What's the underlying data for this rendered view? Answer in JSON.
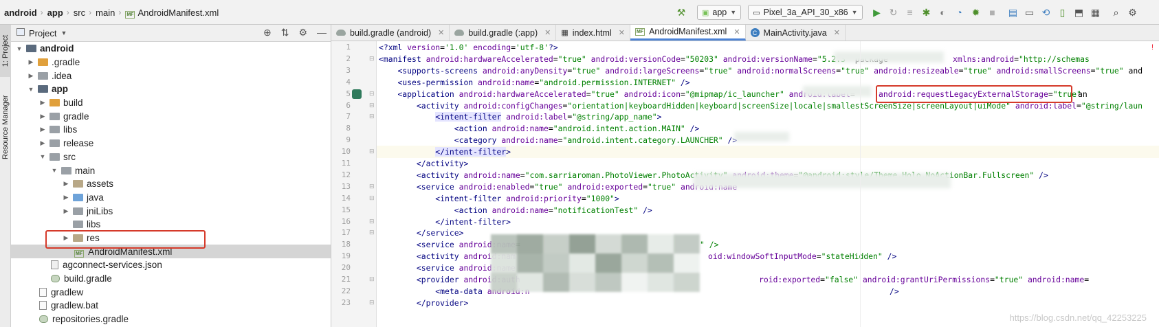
{
  "navbar": {
    "crumbs": [
      "android",
      "app",
      "src",
      "main",
      "AndroidManifest.xml"
    ],
    "file_badge": "MF",
    "run_config": "app",
    "device": "Pixel_3a_API_30_x86"
  },
  "left_strip": {
    "project_tab": "1: Project",
    "resource_tab": "Resource Manager"
  },
  "project_panel": {
    "title": "Project",
    "tree": [
      {
        "label": "android",
        "bold": true,
        "expanded": true,
        "icon": "folder-module"
      },
      {
        "label": ".gradle",
        "bold": false,
        "expanded": false,
        "icon": "folder-orange"
      },
      {
        "label": ".idea",
        "bold": false,
        "expanded": false,
        "icon": "folder-gray"
      },
      {
        "label": "app",
        "bold": true,
        "expanded": true,
        "icon": "folder-module"
      },
      {
        "label": "build",
        "bold": false,
        "expanded": false,
        "icon": "folder-orange"
      },
      {
        "label": "gradle",
        "bold": false,
        "expanded": false,
        "icon": "folder-gray"
      },
      {
        "label": "libs",
        "bold": false,
        "expanded": false,
        "icon": "folder-gray"
      },
      {
        "label": "release",
        "bold": false,
        "expanded": false,
        "icon": "folder-gray"
      },
      {
        "label": "src",
        "bold": false,
        "expanded": true,
        "icon": "folder-gray"
      },
      {
        "label": "main",
        "bold": false,
        "expanded": true,
        "icon": "folder-gray"
      },
      {
        "label": "assets",
        "bold": false,
        "expanded": false,
        "icon": "folder-assets"
      },
      {
        "label": "java",
        "bold": false,
        "expanded": false,
        "icon": "folder-blue"
      },
      {
        "label": "jniLibs",
        "bold": false,
        "expanded": false,
        "icon": "folder-gray"
      },
      {
        "label": "libs",
        "bold": false,
        "expanded": null,
        "icon": "folder-gray"
      },
      {
        "label": "res",
        "bold": false,
        "expanded": false,
        "icon": "folder-res"
      },
      {
        "label": "AndroidManifest.xml",
        "bold": false,
        "expanded": null,
        "icon": "manifest-file"
      },
      {
        "label": "agconnect-services.json",
        "bold": false,
        "expanded": null,
        "icon": "json-file"
      },
      {
        "label": "build.gradle",
        "bold": false,
        "expanded": null,
        "icon": "gradle-file"
      },
      {
        "label": "gradlew",
        "bold": false,
        "expanded": null,
        "icon": "text-file"
      },
      {
        "label": "gradlew.bat",
        "bold": false,
        "expanded": null,
        "icon": "text-file"
      },
      {
        "label": "repositories.gradle",
        "bold": false,
        "expanded": null,
        "icon": "gradle-file"
      }
    ]
  },
  "tabs": [
    {
      "label": "build.gradle (android)",
      "icon": "gradle-icon",
      "active": false
    },
    {
      "label": "build.gradle (:app)",
      "icon": "gradle-icon",
      "active": false
    },
    {
      "label": "index.html",
      "icon": "html-icon",
      "active": false
    },
    {
      "label": "AndroidManifest.xml",
      "icon": "manifest-icon",
      "active": true
    },
    {
      "label": "MainActivity.java",
      "icon": "java-class-icon",
      "active": false
    }
  ],
  "line_numbers": [
    "1",
    "2",
    "3",
    "4",
    "5",
    "6",
    "7",
    "8",
    "9",
    "10",
    "11",
    "12",
    "13",
    "14",
    "15",
    "16",
    "17",
    "18",
    "19",
    "20",
    "21",
    "22",
    "23"
  ],
  "code": [
    "<?xml version='1.0' encoding='utf-8'?>",
    "<manifest android:hardwareAccelerated=\"true\" android:versionCode=\"50203\" android:versionName=\"5.2.3\" package",
    "    <supports-screens android:anyDensity=\"true\" android:largeScreens=\"true\" android:normalScreens=\"true\" android:resizeable=\"true\" android:smallScreens=\"true\" and",
    "    <uses-permission android:name=\"android.permission.INTERNET\" />",
    "    <application android:hardwareAccelerated=\"true\" android:icon=\"@mipmap/ic_launcher\" android:label=",
    "        <activity android:configChanges=\"orientation|keyboardHidden|keyboard|screenSize|locale|smallestScreenSize|screenLayout|uiMode\" android:label=\"@string/laun",
    "            <intent-filter android:label=\"@string/app_name\">",
    "                <action android:name=\"android.intent.action.MAIN\" />",
    "                <category android:name=\"android.intent.category.LAUNCHER\" />",
    "            </intent-filter>",
    "        </activity>",
    "        <activity android:name=\"com.sarriaroman.PhotoViewer.PhotoActivity\" android:theme=\"@android:style/Theme.Holo.NoActionBar.Fullscreen\" />",
    "        <service android:enabled=\"true\" android:exported=\"true\" android:name",
    "            <intent-filter android:priority=\"1000\">",
    "                <action android:name=\"notificationTest\" />",
    "            </intent-filter>",
    "        </service>",
    "        <service android:name=",
    "        <activity android:nam",
    "        <service android:name",
    "        <provider android:auth",
    "            <meta-data android:n",
    "        </provider>"
  ],
  "code_extras": {
    "line2_tail": "xmlns:android=\"http://schemas",
    "line5_highlight": "android:requestLegacyExternalStorage=\"true\"",
    "line5_tail": "an",
    "line18_tail": "\" />",
    "line19_tail": "oid:windowSoftInputMode=\"stateHidden\" />",
    "line21_tail": "roid:exported=\"false\" android:grantUriPermissions=\"true\" android:name=",
    "line22_tail": "/>"
  },
  "watermark": "https://blog.csdn.net/qq_42253225",
  "colors": {
    "tag": "#000080",
    "attribute": "#660099",
    "value": "#008000",
    "annotation_box": "#d53a2a",
    "active_tab_underline": "#4c83d6"
  }
}
